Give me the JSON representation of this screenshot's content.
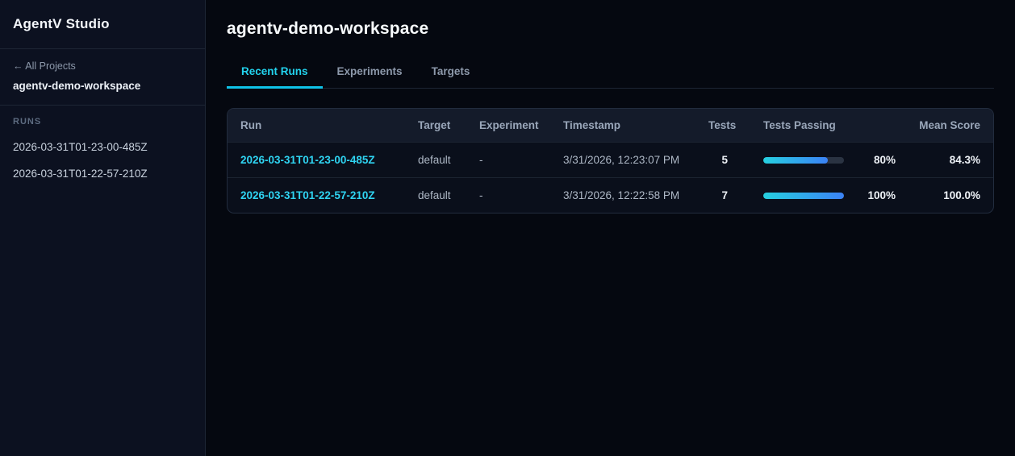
{
  "app": {
    "title": "AgentV Studio"
  },
  "sidebar": {
    "back_link": "← All Projects",
    "workspace_name": "agentv-demo-workspace",
    "runs_label": "RUNS",
    "runs": [
      "2026-03-31T01-23-00-485Z",
      "2026-03-31T01-22-57-210Z"
    ]
  },
  "main": {
    "title": "agentv-demo-workspace",
    "tabs": [
      {
        "label": "Recent Runs",
        "active": true
      },
      {
        "label": "Experiments",
        "active": false
      },
      {
        "label": "Targets",
        "active": false
      }
    ],
    "table": {
      "columns": [
        "Run",
        "Target",
        "Experiment",
        "Timestamp",
        "Tests",
        "Tests Passing",
        "Mean Score"
      ],
      "rows": [
        {
          "run": "2026-03-31T01-23-00-485Z",
          "target": "default",
          "experiment": "-",
          "timestamp": "3/31/2026, 12:23:07 PM",
          "tests": "5",
          "passing_pct": 80,
          "passing_label": "80%",
          "mean_score": "84.3%"
        },
        {
          "run": "2026-03-31T01-22-57-210Z",
          "target": "default",
          "experiment": "-",
          "timestamp": "3/31/2026, 12:22:58 PM",
          "tests": "7",
          "passing_pct": 100,
          "passing_label": "100%",
          "mean_score": "100.0%"
        }
      ]
    }
  },
  "colors": {
    "accent_cyan": "#22d3ee",
    "accent_blue": "#3b82f6",
    "sidebar_bg": "#0c1120",
    "main_bg": "#050810",
    "card_header_bg": "#141b2a"
  }
}
